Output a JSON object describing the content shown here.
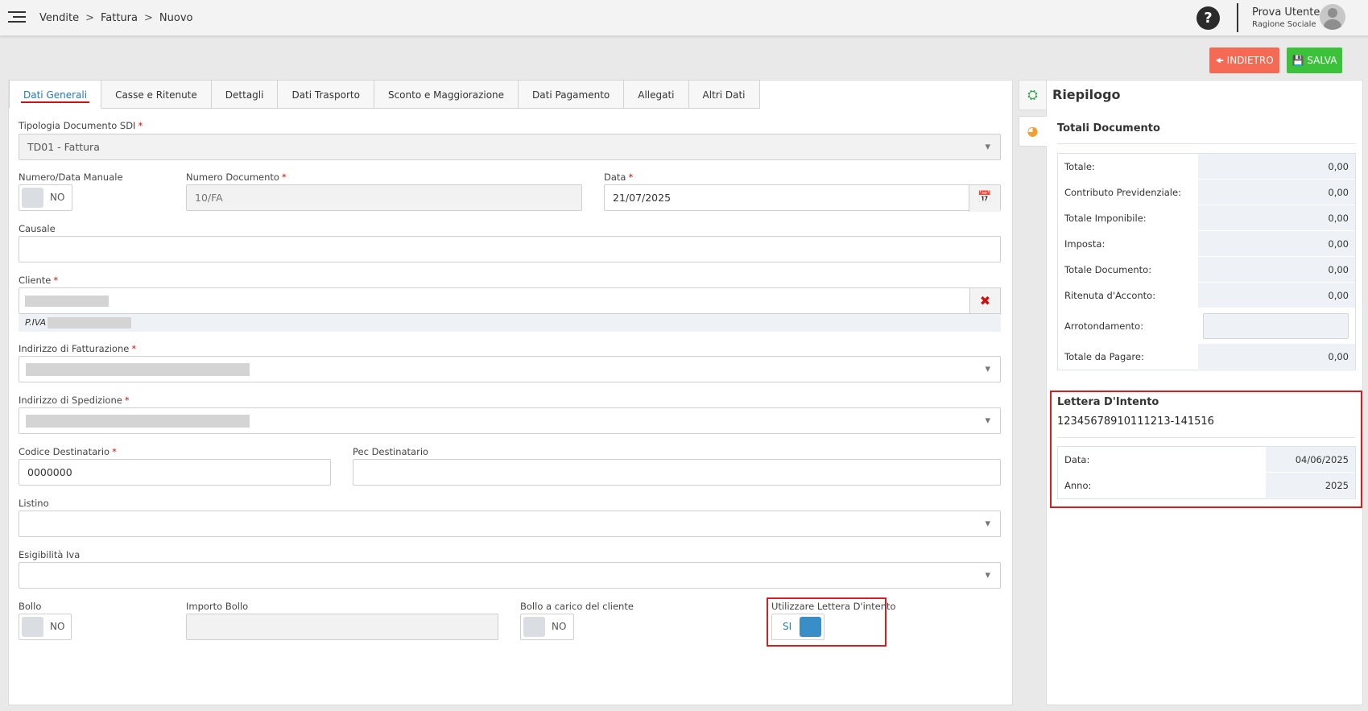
{
  "breadcrumb": [
    "Vendite",
    "Fattura",
    "Nuovo"
  ],
  "breadcrumb_sep": ">",
  "user": {
    "name": "Prova Utente",
    "company": "Ragione Sociale"
  },
  "help_label": "?",
  "actions": {
    "back_label": "INDIETRO",
    "save_label": "SALVA"
  },
  "tabs": [
    "Dati Generali",
    "Casse e Ritenute",
    "Dettagli",
    "Dati Trasporto",
    "Sconto e Maggiorazione",
    "Dati Pagamento",
    "Allegati",
    "Altri Dati"
  ],
  "form": {
    "tipologia": {
      "label": "Tipologia Documento SDI",
      "value": "TD01 - Fattura"
    },
    "numero_manuale": {
      "label": "Numero/Data Manuale",
      "value": "NO"
    },
    "numero_documento": {
      "label": "Numero Documento",
      "placeholder": "10/FA"
    },
    "data": {
      "label": "Data",
      "value": "21/07/2025"
    },
    "causale": {
      "label": "Causale",
      "value": ""
    },
    "cliente": {
      "label": "Cliente",
      "piva_label": "P.IVA"
    },
    "indirizzo_fatturazione": {
      "label": "Indirizzo di Fatturazione"
    },
    "indirizzo_spedizione": {
      "label": "Indirizzo di Spedizione"
    },
    "codice_destinatario": {
      "label": "Codice Destinatario",
      "value": "0000000"
    },
    "pec_destinatario": {
      "label": "Pec Destinatario",
      "value": ""
    },
    "listino": {
      "label": "Listino",
      "value": ""
    },
    "esigibilita": {
      "label": "Esigibilità Iva",
      "value": ""
    },
    "bollo": {
      "label": "Bollo",
      "value": "NO"
    },
    "importo_bollo": {
      "label": "Importo Bollo",
      "value": ""
    },
    "bollo_cliente": {
      "label": "Bollo a carico del cliente",
      "value": "NO"
    },
    "lettera_intento": {
      "label": "Utilizzare Lettera D'intento",
      "value": "SI"
    }
  },
  "riepilogo": {
    "title": "Riepilogo",
    "totali_title": "Totali Documento",
    "rows": [
      {
        "label": "Totale:",
        "value": "0,00"
      },
      {
        "label": "Contributo Previdenziale:",
        "value": "0,00"
      },
      {
        "label": "Totale Imponibile:",
        "value": "0,00"
      },
      {
        "label": "Imposta:",
        "value": "0,00"
      },
      {
        "label": "Totale Documento:",
        "value": "0,00"
      },
      {
        "label": "Ritenuta d'Acconto:",
        "value": "0,00"
      },
      {
        "label": "Arrotondamento:",
        "value": ""
      },
      {
        "label": "Totale da Pagare:",
        "value": "0,00"
      }
    ],
    "lettera": {
      "title": "Lettera D'Intento",
      "number": "12345678910111213-141516",
      "rows": [
        {
          "label": "Data:",
          "value": "04/06/2025"
        },
        {
          "label": "Anno:",
          "value": "2025"
        }
      ]
    }
  },
  "icons": {
    "calendar": "calendar-icon",
    "clear": "times-icon",
    "lifebuoy": "lifebuoy-icon",
    "dashboard": "dashboard-icon"
  },
  "colors": {
    "accent": "#1f7ab9",
    "danger": "#d01010",
    "back_button": "#f56a55",
    "save_button": "#3cc13b",
    "toggle_on": "#3a8ec8"
  }
}
